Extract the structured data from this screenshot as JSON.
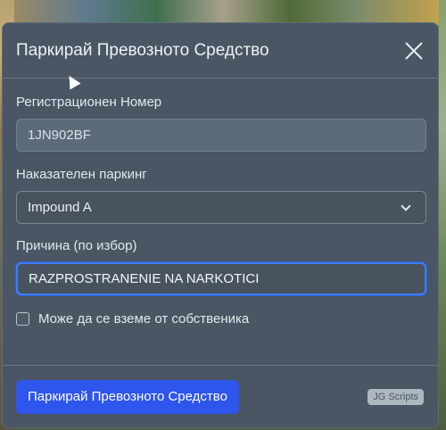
{
  "modal": {
    "title": "Паркирай Превозното Средство",
    "fields": {
      "plate_label": "Регистрационен Номер",
      "plate_value": "1JN902BF",
      "parking_label": "Наказателен паркинг",
      "parking_selected": "Impound A",
      "reason_label": "Причина (по избор)",
      "reason_value": "RAZPROSTRANENIE NA NARKOTICI",
      "owner_checkbox_label": "Може да се вземе от собственика",
      "owner_checkbox_checked": false
    },
    "footer": {
      "submit_label": "Паркирай Превозното Средство",
      "badge": "JG Scripts"
    }
  },
  "colors": {
    "panel": "#4a5663",
    "primary": "#2e55ec",
    "focus_border": "#3d7dff"
  },
  "icons": {
    "close": "close-icon",
    "dropdown": "chevron-down-icon",
    "cursor": "mouse-pointer-icon"
  }
}
